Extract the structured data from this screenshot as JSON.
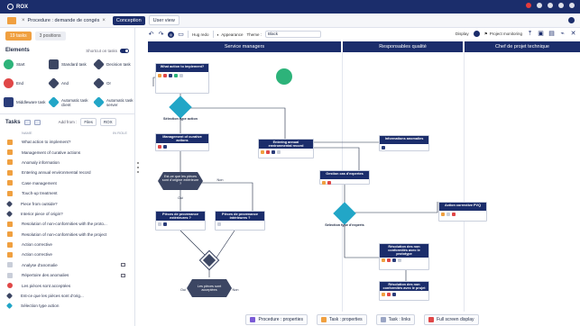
{
  "app": {
    "name": "ROX"
  },
  "tabs": {
    "document": "Procedure : demande de congés",
    "conception": "Conception",
    "user_view": "User view"
  },
  "left": {
    "tasks_count": "19 tasks",
    "positions_count": "3 positions",
    "elements_title": "Elements",
    "shortcut_label": "Shortcut on tasks",
    "elements": [
      {
        "label": "Start"
      },
      {
        "label": "Standard task"
      },
      {
        "label": "Decision task"
      },
      {
        "label": "End"
      },
      {
        "label": "And"
      },
      {
        "label": "Or"
      },
      {
        "label": "Middleware task"
      },
      {
        "label": "Automatic task client"
      },
      {
        "label": "Automatic task server"
      }
    ],
    "tasks_title": "Tasks",
    "add_from_label": "Add from :",
    "add_from_value": "Files",
    "rox_label": "ROX",
    "col_name": "NAME",
    "col_type": "IN ROLE",
    "tasks": [
      {
        "label": "What action to implement?"
      },
      {
        "label": "Management of curative actions"
      },
      {
        "label": "Anomaly information"
      },
      {
        "label": "Entering annual environmental record"
      },
      {
        "label": "Case management"
      },
      {
        "label": "Touch-up treatment"
      },
      {
        "label": "Piece from outside?"
      },
      {
        "label": "Interior piece of origin?"
      },
      {
        "label": "Resolution of non-conformities with the proto..."
      },
      {
        "label": "Resolution of non-conformities with the project"
      },
      {
        "label": "Action corrective"
      },
      {
        "label": "Action corrective"
      },
      {
        "label": "Analyse d'anomalie"
      },
      {
        "label": "Répertoire des anomalies"
      },
      {
        "label": "Les pièces sont acceptées"
      },
      {
        "label": "Est-ce que les pièces sont d'orig..."
      },
      {
        "label": "Sélection type action"
      }
    ]
  },
  "toolbar": {
    "zoom_label": "Hug redo",
    "appearance_label": "Appearance",
    "theme_label": "Theme :",
    "theme_value": "Black",
    "display_label": "Display",
    "project_monitoring_label": "Project monitoring"
  },
  "lanes": [
    {
      "name": "Service managers"
    },
    {
      "name": "Responsables qualité"
    },
    {
      "name": "Chef de projet technique"
    }
  ],
  "diagram": {
    "n_what_action": "What action to implement?",
    "n_selection": "Sélection type action",
    "n_management": "Management of curative actions",
    "n_entering": "Entering annual environmental record",
    "n_info": "Informations anomalies",
    "n_gestion": "Gestion cas d'expertes",
    "n_est_ce": "Est-ce que les pièces sont d'origine extérieure ?",
    "n_oui": "Oui",
    "n_non": "Non",
    "n_pieces_ext": "Pièces de provenance extérieures ?",
    "n_pieces_int": "Pièces de provenance intérieures ?",
    "n_selection2": "Sélection type d'experts",
    "n_action_cor": "Action corrective PVQ",
    "n_resolution1": "Résolution des non conformités avec le prototype",
    "n_resolution2": "Résolution des non conformités avec le projet",
    "n_acceptees": "Les pièces sont acceptées",
    "n_oui2": "Oui",
    "n_non2": "Non"
  },
  "bottom": {
    "procedure_props": "Procedure : properties",
    "task_props": "Task : properties",
    "task_links": "Task : links",
    "full_screen": "Full screen display"
  },
  "colors": {
    "navy": "#1b2d6b",
    "orange": "#f0a040",
    "green": "#2db37a",
    "red": "#e04747",
    "cyan": "#22a6c7"
  }
}
